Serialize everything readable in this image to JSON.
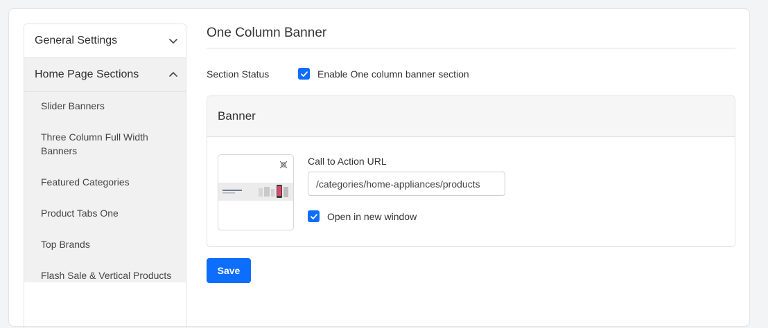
{
  "sidebar": {
    "general_settings": "General Settings",
    "home_page_sections": "Home Page Sections",
    "items": [
      "Slider Banners",
      "Three Column Full Width Banners",
      "Featured Categories",
      "Product Tabs One",
      "Top Brands",
      "Flash Sale & Vertical Products"
    ]
  },
  "main": {
    "title": "One Column Banner",
    "section_status_label": "Section Status",
    "enable_label": "Enable One column banner section",
    "enable_checked": true,
    "banner": {
      "heading": "Banner",
      "cta_label": "Call to Action URL",
      "cta_value": "/categories/home-appliances/products",
      "new_window_label": "Open in new window",
      "new_window_checked": true
    },
    "save_label": "Save"
  },
  "colors": {
    "primary": "#0d6efd",
    "sidebar_bg": "#f1f1f1"
  },
  "icons": {
    "collapsed": "chevron-down-icon",
    "expanded": "chevron-up-icon",
    "remove": "remove-image-icon",
    "check": "check-icon"
  }
}
